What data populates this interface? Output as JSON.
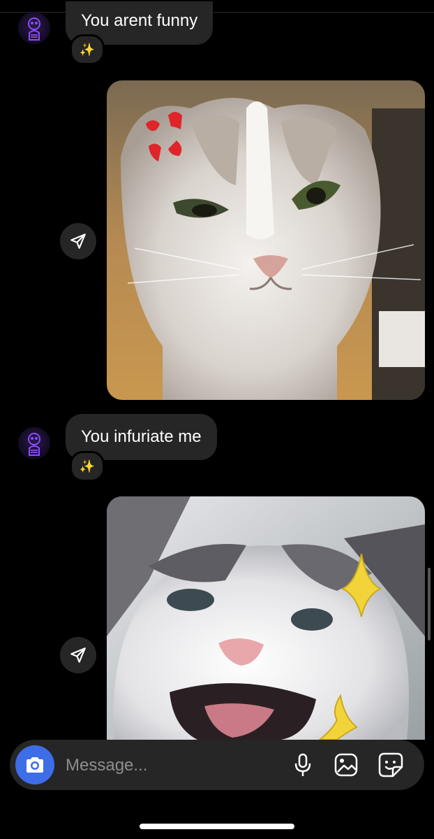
{
  "thread": {
    "messages": [
      {
        "text": "You arent funny",
        "reaction": "✨"
      },
      {
        "text": "You infuriate me",
        "reaction": "✨"
      }
    ],
    "photos": [
      {
        "alt": "angry grey and white cat with anger symbol sticker"
      },
      {
        "alt": "screaming kitten with yellow sparkle stickers"
      }
    ]
  },
  "composer": {
    "placeholder": "Message..."
  },
  "colors": {
    "background": "#000000",
    "bubble": "#262626",
    "accent_blue": "#3d6ee8",
    "placeholder": "#8e8e8e"
  },
  "icons": [
    "avatar-skeleton-icon",
    "sparkles-icon",
    "send-icon",
    "camera-icon",
    "microphone-icon",
    "gallery-icon",
    "sticker-icon"
  ]
}
